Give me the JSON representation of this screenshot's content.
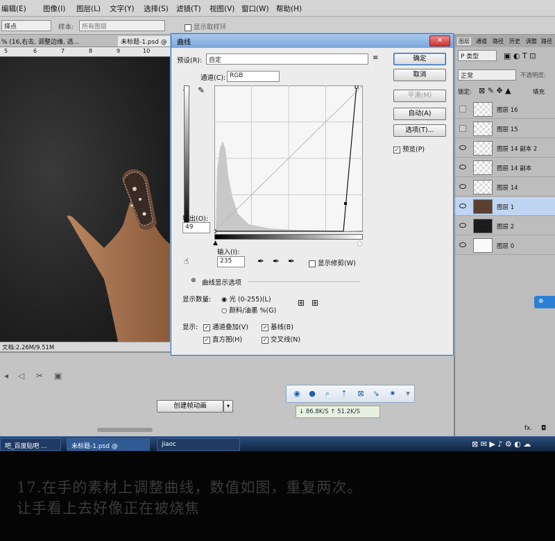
{
  "menu": [
    "编辑(E)",
    "图像(I)",
    "图层(L)",
    "文字(Y)",
    "选择(S)",
    "滤镜(T)",
    "视图(V)",
    "窗口(W)",
    "帮助(H)"
  ],
  "options_bar": {
    "left_dropdown": "择点",
    "sample_label": "样本:",
    "sample_value": "所有图层",
    "show_ring": "显示取样环"
  },
  "doc_tabs": [
    "% (16,右击, 调整边缘, 选...",
    "未标题-1.psd @"
  ],
  "ruler_ticks": [
    "5",
    "6",
    "7",
    "8",
    "9",
    "10"
  ],
  "status_text": "文档:2.26M/9.51M",
  "dialog": {
    "title": "曲线",
    "preset_label": "预设(R):",
    "preset_value": "自定",
    "channel_label": "通道(C):",
    "channel_value": "RGB",
    "output_label": "输出(O):",
    "output_value": "49",
    "input_label": "输入(I):",
    "input_value": "235",
    "show_clipping": "显示修剪(W)",
    "curve_options": "曲线显示选项",
    "show_amount_label": "显示数量:",
    "light_option": "光 (0-255)(L)",
    "pigment_option": "颜料/油墨 %(G)",
    "show_label": "显示:",
    "channel_overlay": "通道叠加(V)",
    "baseline": "基线(B)",
    "histogram": "直方图(H)",
    "intersection": "交叉线(N)",
    "buttons": {
      "ok": "确定",
      "cancel": "取消",
      "smooth": "平滑(M)",
      "auto": "自动(A)",
      "options": "选项(T)..."
    },
    "preview": "预览(P)"
  },
  "layers_panel": {
    "tabs": [
      "图层",
      "通道",
      "路径",
      "历史",
      "调整",
      "路径"
    ],
    "kind": "P 类型",
    "blend": "正常",
    "opacity_label": "不透明度:",
    "lock_label": "锁定:",
    "fill_label": "填充",
    "layers": [
      {
        "name": "图层 16",
        "visible": false,
        "selected": false
      },
      {
        "name": "图层 15",
        "visible": false,
        "selected": false
      },
      {
        "name": "图层 14 副本 2",
        "visible": true,
        "selected": false
      },
      {
        "name": "图层 14 副本",
        "visible": true,
        "selected": false
      },
      {
        "name": "图层 14",
        "visible": true,
        "selected": false
      },
      {
        "name": "图层 1",
        "visible": true,
        "selected": true
      },
      {
        "name": "图层 2",
        "visible": true,
        "selected": false
      },
      {
        "name": "图层 0",
        "visible": true,
        "selected": false
      }
    ]
  },
  "timeline": {
    "create_button": "创建帧动画"
  },
  "netspeed": {
    "down": "↓ 86.8K/S",
    "up": "↑ 51.2K/S"
  },
  "taskbar": {
    "items": [
      "吧_百度贴吧 ...",
      "未标题-1.psd @",
      "jiaoc"
    ]
  },
  "caption": {
    "line1": "17.在手的素材上调整曲线，数值如图，重复两次。",
    "line2": "让手看上去好像正在被烧焦"
  }
}
